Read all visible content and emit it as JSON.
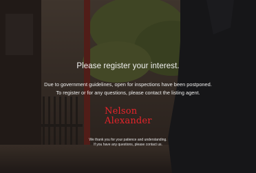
{
  "notice": {
    "headline": "Please register your interest.",
    "line1": "Due to government guidelines, open for inspections have been postponed.",
    "line2": "To register or for any questions, please contact the listing agent.",
    "thanks_line1": "We thank you for your patience and understanding.",
    "thanks_line2": "If you have any questions, please contact us."
  },
  "brand": {
    "logo_line1": "Nelson",
    "logo_line2": "Alexander",
    "color": "#e8242b"
  }
}
